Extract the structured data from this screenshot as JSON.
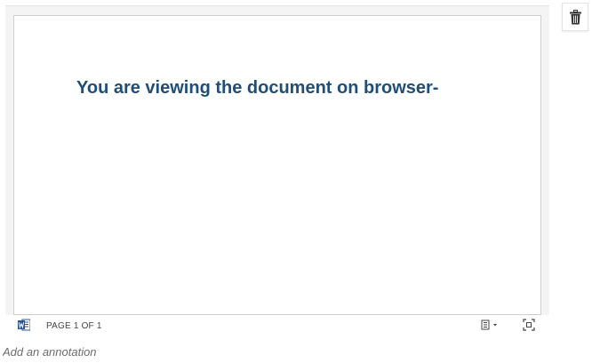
{
  "document": {
    "body_text": "You are viewing the document on browser-"
  },
  "statusbar": {
    "page_count": "PAGE 1 OF 1",
    "word_icon": "word-document-icon",
    "view_icon": "reading-view-icon",
    "fullscreen_icon": "fullscreen-icon"
  },
  "actions": {
    "delete_icon": "trash-icon"
  },
  "annotation": {
    "placeholder": "Add an annotation",
    "value": ""
  },
  "colors": {
    "text_accent": "#1f4e79",
    "word_blue": "#2b579a"
  }
}
